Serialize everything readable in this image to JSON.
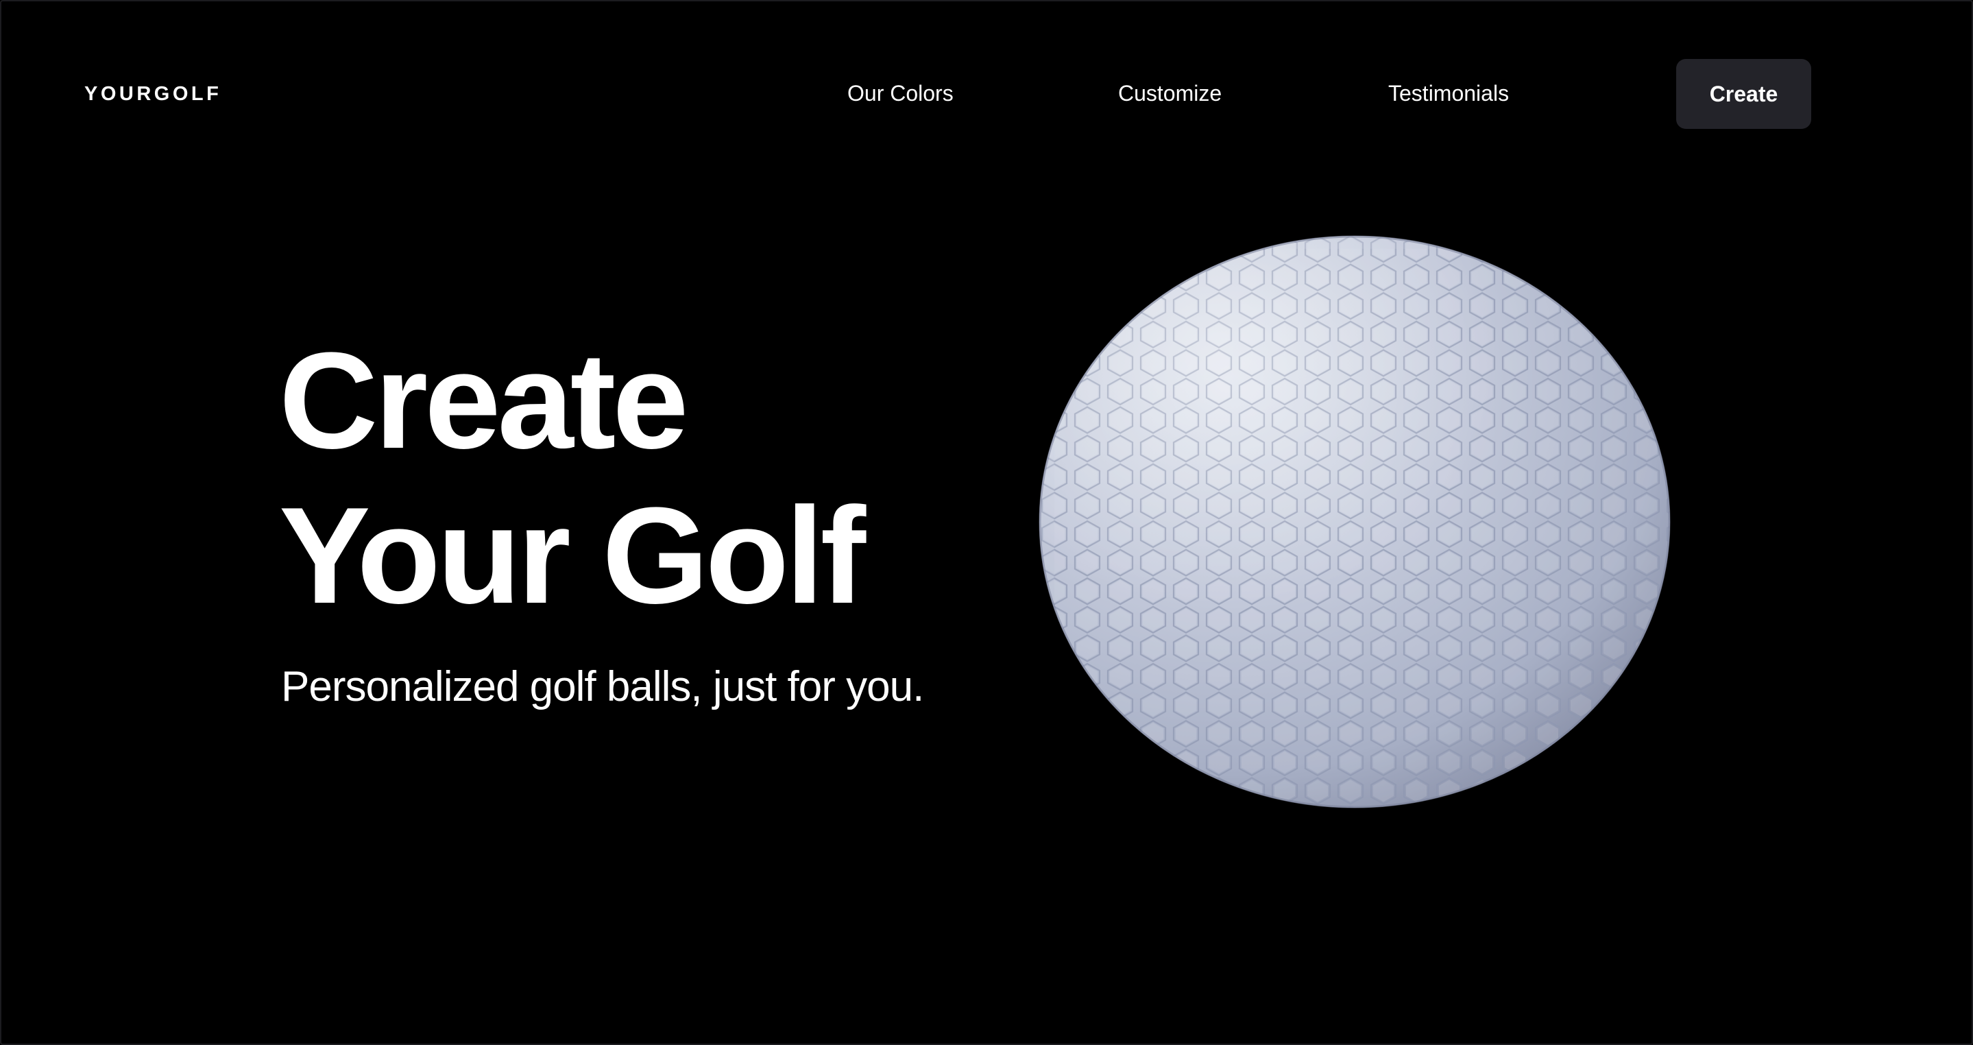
{
  "header": {
    "logo": "YOURGOLF",
    "nav": [
      {
        "label": "Our Colors"
      },
      {
        "label": "Customize"
      },
      {
        "label": "Testimonials"
      }
    ],
    "cta_label": "Create"
  },
  "hero": {
    "title_line1": "Create",
    "title_line2": "Your Golf",
    "subtitle": "Personalized golf balls, just for you."
  },
  "visual": {
    "image": "golf-ball",
    "ball_color": "#c3c9da",
    "background_color": "#000000",
    "button_color": "#232329"
  }
}
